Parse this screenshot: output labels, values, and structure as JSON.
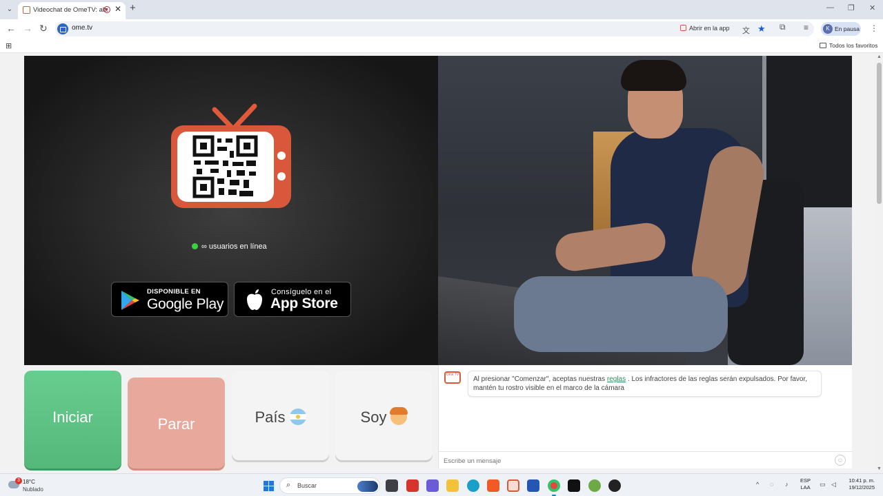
{
  "browser": {
    "tab_title": "Videochat de OmeTV: alternativa",
    "tab_close": "✕",
    "new_tab": "+",
    "url": "ome.tv",
    "open_in_app": "Abrir en la app",
    "profile_initial": "K",
    "profile_status": "En pausa",
    "bookmarks_folder": "Todos los favoritos",
    "window_controls": {
      "minimize": "—",
      "restore": "❐",
      "close": "✕"
    }
  },
  "left_panel": {
    "online_text": "∞ usuarios en línea",
    "google_play": {
      "small": "DISPONIBLE EN",
      "big": "Google Play"
    },
    "app_store": {
      "small": "Consíguelo en el",
      "big": "App Store"
    }
  },
  "controls": {
    "start": "Iniciar",
    "stop": "Parar",
    "country": "País",
    "gender": "Soy"
  },
  "chat": {
    "avatar_text": "Ome TV",
    "message_before": "Al presionar \"Comenzar\", aceptas nuestras ",
    "message_link": "reglas",
    "message_after": " . Los infractores de las reglas serán expulsados. Por favor, mantén tu rostro visible en el marco de la cámara",
    "input_placeholder": "Escribe un mensaje"
  },
  "taskbar": {
    "weather_temp": "18°C",
    "weather_desc": "Nublado",
    "weather_badge": "3",
    "search_placeholder": "Buscar",
    "language_line1": "ESP",
    "language_line2": "LAA",
    "time": "10:41 p. m.",
    "date": "19/12/2025"
  },
  "colors": {
    "start_button": "#5fc486",
    "stop_button": "#e8a89b",
    "brand_tv": "#d9583b",
    "online_dot": "#3ad23a",
    "link": "#2c8f5b"
  }
}
